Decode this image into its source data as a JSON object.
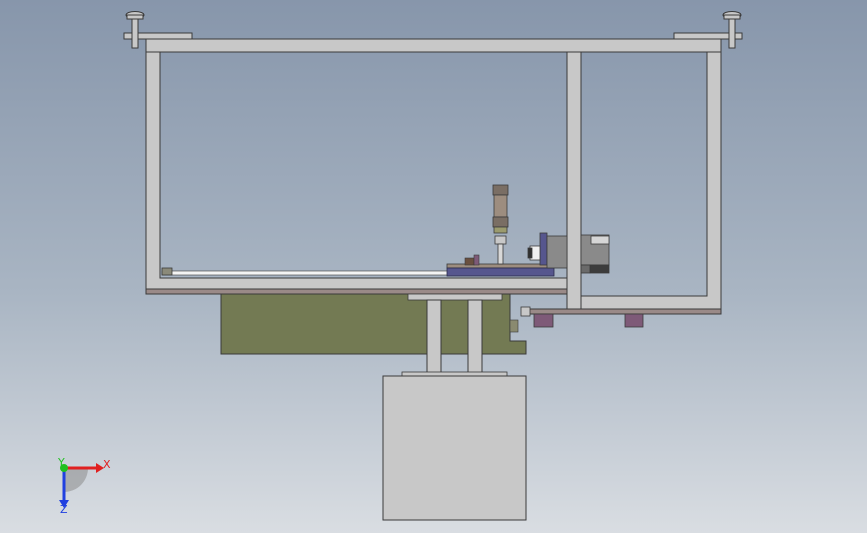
{
  "triad": {
    "x_label": "X",
    "y_label": "Y",
    "z_label": "Z",
    "x_color": "#e02020",
    "y_color": "#20c020",
    "z_color": "#2040e0"
  },
  "colors": {
    "frame": "#c8c8c8",
    "frame_edge": "#3a3a3a",
    "gearbox": "#737a53",
    "motor_body": "#c6c6c6",
    "rail": "#9a8a88",
    "blue_block": "#56568e",
    "purple_pad": "#7e5a78",
    "rod": "#9d8d7f"
  }
}
